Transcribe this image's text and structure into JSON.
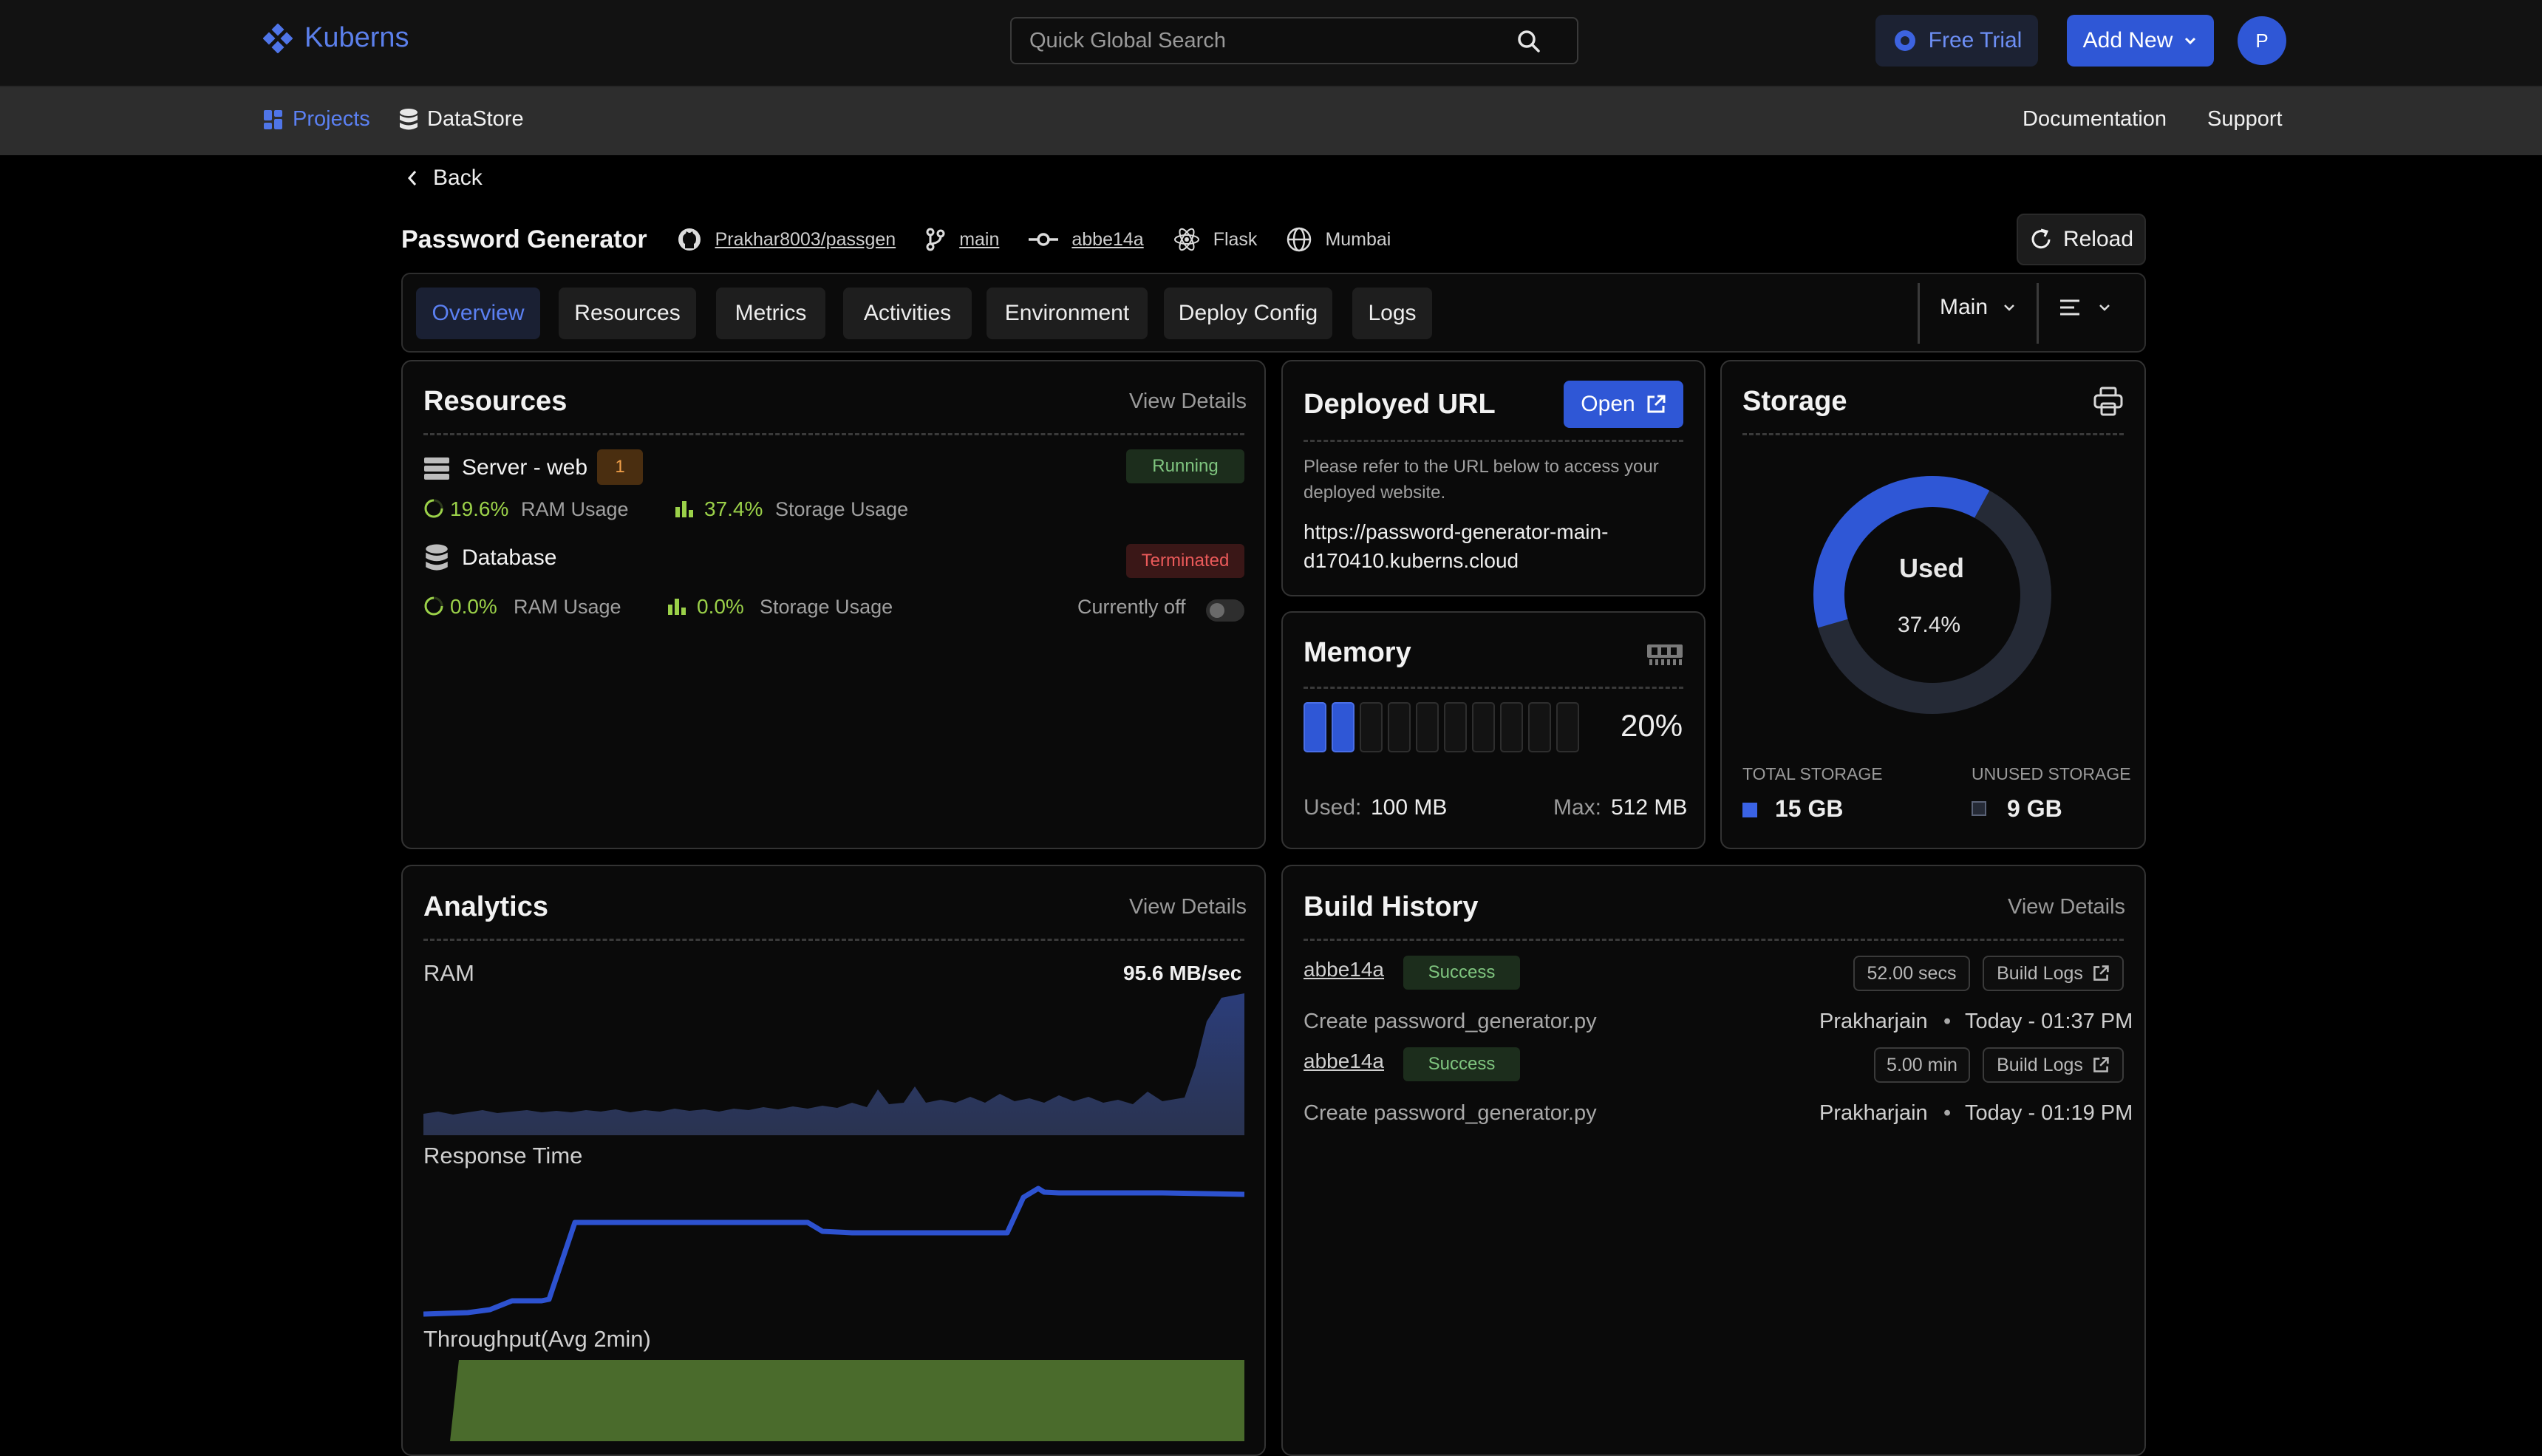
{
  "header": {
    "logo_text": "Kuberns",
    "search_placeholder": "Quick Global Search",
    "free_trial_label": "Free Trial",
    "add_new_label": "Add New",
    "avatar_initial": "P"
  },
  "subnav": {
    "projects_label": "Projects",
    "datastore_label": "DataStore",
    "documentation_label": "Documentation",
    "support_label": "Support"
  },
  "project": {
    "back_label": "Back",
    "name": "Password Generator",
    "repo": "Prakhar8003/passgen",
    "branch": "main",
    "commit": "abbe14a",
    "framework": "Flask",
    "region": "Mumbai",
    "reload_label": "Reload"
  },
  "tabs": [
    {
      "label": "Overview",
      "active": true
    },
    {
      "label": "Resources"
    },
    {
      "label": "Metrics"
    },
    {
      "label": "Activities"
    },
    {
      "label": "Environment"
    },
    {
      "label": "Deploy Config"
    },
    {
      "label": "Logs"
    }
  ],
  "env_select": "Main",
  "resources": {
    "title": "Resources",
    "view_details": "View Details",
    "server": {
      "name": "Server - web",
      "count": "1",
      "status": "Running",
      "ram_value": "19.6%",
      "ram_label": "RAM Usage",
      "storage_value": "37.4%",
      "storage_label": "Storage Usage"
    },
    "database": {
      "name": "Database",
      "status": "Terminated",
      "ram_value": "0.0%",
      "ram_label": "RAM Usage",
      "storage_value": "0.0%",
      "storage_label": "Storage Usage",
      "toggle_label": "Currently off"
    }
  },
  "deployed_url": {
    "title": "Deployed URL",
    "open_label": "Open",
    "description": "Please refer to the URL below to access your deployed website.",
    "url_line1": "https://password-generator-main-",
    "url_line2": "d170410.kuberns.cloud"
  },
  "memory": {
    "title": "Memory",
    "percent_label": "20%",
    "used_fraction": 0.2,
    "used_label": "Used:",
    "used_value": "100 MB",
    "max_label": "Max:",
    "max_value": "512 MB"
  },
  "storage": {
    "title": "Storage",
    "center_label": "Used",
    "percent_label": "37.4%",
    "used_fraction": 0.374,
    "total_label": "TOTAL STORAGE",
    "total_value": "15 GB",
    "unused_label": "UNUSED STORAGE",
    "unused_value": "9 GB",
    "colors": {
      "used": "#2f57d6",
      "unused": "#252a36"
    }
  },
  "analytics": {
    "title": "Analytics",
    "view_details": "View Details",
    "ram_label": "RAM",
    "ram_value": "95.6 MB/sec",
    "response_label": "Response Time",
    "throughput_label": "Throughput(Avg 2min)"
  },
  "build_history": {
    "title": "Build History",
    "view_details": "View Details",
    "builds": [
      {
        "commit": "abbe14a",
        "status": "Success",
        "duration": "52.00 secs",
        "logs_label": "Build Logs",
        "message": "Create password_generator.py",
        "author": "Prakharjain",
        "time": "Today - 01:37 PM"
      },
      {
        "commit": "abbe14a",
        "status": "Success",
        "duration": "5.00 min",
        "logs_label": "Build Logs",
        "message": "Create password_generator.py",
        "author": "Prakharjain",
        "time": "Today - 01:19 PM"
      }
    ]
  },
  "colors": {
    "accent": "#2f57d6",
    "success": "#7fc57f",
    "danger": "#ea5a5a",
    "usage": "#9bd149"
  }
}
